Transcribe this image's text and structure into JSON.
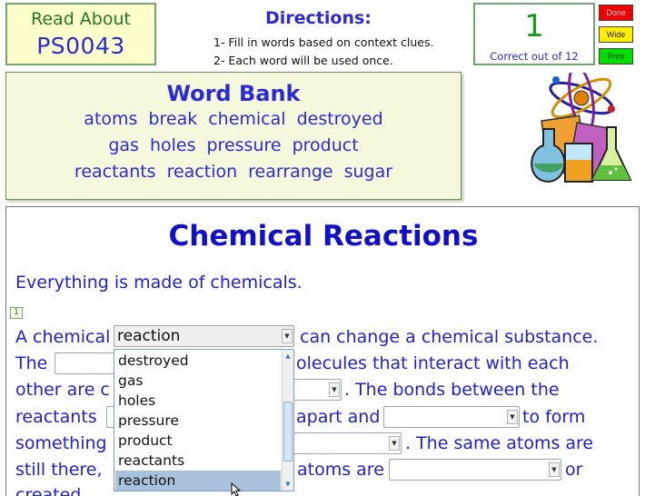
{
  "header": {
    "read_about_label": "Read About",
    "read_about_id": "PS0043",
    "directions_title": "Directions:",
    "directions_line1": "1- Fill in words based on context clues.",
    "directions_line2": "2- Each word will be used once.",
    "score_value": "1",
    "score_label": "Correct out of 12",
    "buttons": {
      "done": "Done",
      "wide": "Wide",
      "print": "Print"
    }
  },
  "word_bank": {
    "title": "Word Bank",
    "rows": [
      [
        "atoms",
        "break",
        "chemical",
        "destroyed"
      ],
      [
        "gas",
        "holes",
        "pressure",
        "product"
      ],
      [
        "reactants",
        "reaction",
        "rearrange",
        "sugar"
      ]
    ]
  },
  "clipart": {
    "icon": "science-lab-icon"
  },
  "passage": {
    "title": "Chemical Reactions",
    "intro": "Everything is made of chemicals.",
    "marker": "1",
    "line1_a": "A chemical",
    "line1_b": "can change a chemical substance.",
    "line2_a": "The",
    "line2_b": "olecules that interact with each",
    "line3_a": "other are c",
    "line3_b": ". The bonds between the",
    "line4_a": "reactants",
    "line4_b": "apart and",
    "line4_c": "to form",
    "line5_a": "something",
    "line5_b": ". The same atoms are",
    "line6_a": "still there,",
    "line6_b": "atoms are",
    "line6_c": "or",
    "line7_a": "created.",
    "select_1_value": "reaction"
  },
  "dropdown": {
    "options": [
      "destroyed",
      "gas",
      "holes",
      "pressure",
      "product",
      "reactants",
      "reaction"
    ],
    "highlighted": "reaction"
  },
  "colors": {
    "text_blue": "#2020d8",
    "title_blue": "#1010cc",
    "accent_green": "#1f7a1f",
    "done_red": "#ee0000",
    "wide_yellow": "#ffee00",
    "print_green": "#00dd00",
    "highlight": "#a9c2dc"
  }
}
